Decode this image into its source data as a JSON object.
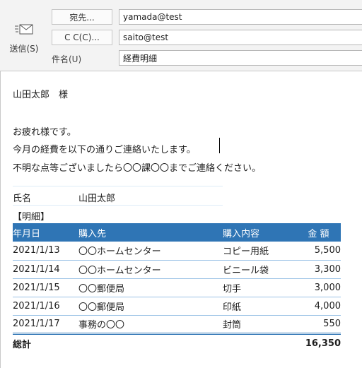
{
  "toolbar": {
    "send_label": "送信(S)"
  },
  "fields": {
    "to_button": "宛先...",
    "cc_button": "C C(C)...",
    "subject_label": "件名(U)",
    "to_value": "yamada@test",
    "cc_value": "saito@test",
    "subject_value": "経費明細"
  },
  "message": {
    "salutation": "山田太郎　様",
    "line1": "お疲れ様です。",
    "line2": "今月の経費を以下の通りご連絡いたします。",
    "line3": "不明な点等ございましたら〇〇課〇〇までご連絡ください。",
    "name_label": "氏名",
    "name_value": "山田太郎",
    "section_label": "【明細】"
  },
  "table": {
    "headers": [
      "年月日",
      "購入先",
      "購入内容",
      "金 額"
    ],
    "rows": [
      {
        "date": "2021/1/13",
        "shop": "〇〇ホームセンター",
        "item": "コピー用紙",
        "amount": "5,500"
      },
      {
        "date": "2021/1/14",
        "shop": "〇〇ホームセンター",
        "item": "ビニール袋",
        "amount": "3,300"
      },
      {
        "date": "2021/1/15",
        "shop": "〇〇郵便局",
        "item": "切手",
        "amount": "3,000"
      },
      {
        "date": "2021/1/16",
        "shop": "〇〇郵便局",
        "item": "印紙",
        "amount": "4,000"
      },
      {
        "date": "2021/1/17",
        "shop": "事務の〇〇",
        "item": "封筒",
        "amount": "550"
      }
    ],
    "total_label": "総計",
    "total_value": "16,350"
  },
  "icons": {
    "send": "envelope-send-icon"
  },
  "colors": {
    "header_fill": "#2f75b5",
    "row_line": "#9bc2e6",
    "pane_bg": "#f3f3f3"
  }
}
